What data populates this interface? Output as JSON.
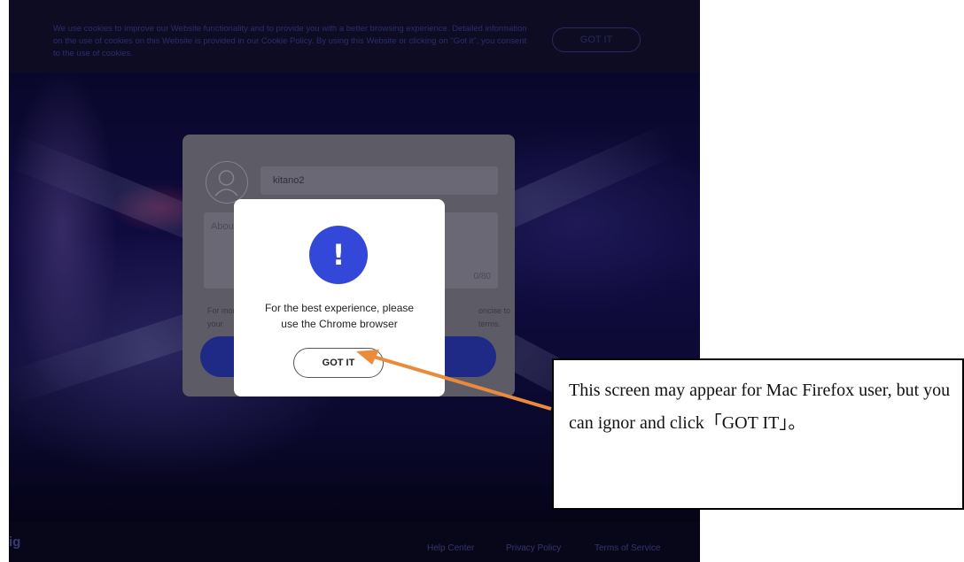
{
  "cookie_banner": {
    "text": "We use cookies to improve our Website functionality and to provide you with a better browsing experience. Detailed information on the use of cookies on this Website is provided in our Cookie Policy. By using this Website or clicking on \"Got it\", you consent to the use of cookies.",
    "button_label": "GOT IT"
  },
  "profile_card": {
    "username": "kitano2",
    "about_placeholder": "About",
    "char_counter": "0/80",
    "terms_left": "For mor\nyour",
    "terms_right": "oncise to\nterms."
  },
  "modal": {
    "message": "For the best experience, please use the Chrome browser",
    "button_label": "GOT IT",
    "icon_glyph": "!",
    "icon_color": "#3348d8"
  },
  "footer": {
    "logo_fragment": "ig",
    "links": [
      "Help Center",
      "Privacy Policy",
      "Terms of Service"
    ]
  },
  "annotation": {
    "text": "This screen may appear for Mac Firefox user, but you can ignor and click「GOT IT」。",
    "arrow_color": "#e98a3c"
  }
}
